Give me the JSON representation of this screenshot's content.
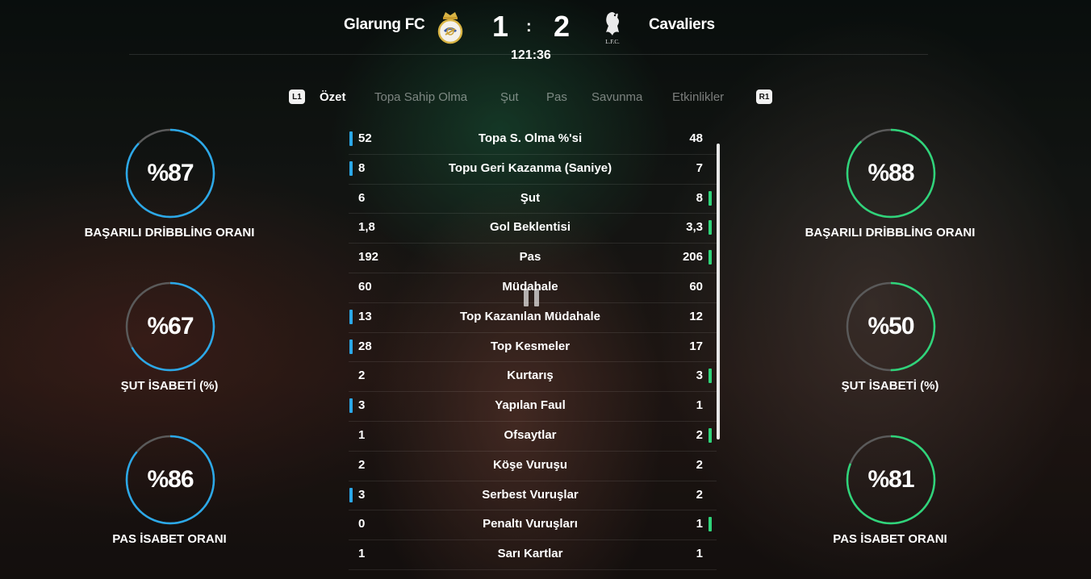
{
  "scoreboard": {
    "home_team": "Glarung FC",
    "away_team": "Cavaliers",
    "home_score": "1",
    "away_score": "2",
    "separator": ":",
    "match_time": "121:36",
    "home_crest_icon": "white-gold-club-crest-icon",
    "away_crest_icon": "liverbird-lfc-crest-icon",
    "away_crest_text": "L.F.C."
  },
  "tabs": {
    "left_button": "L1",
    "right_button": "R1",
    "items": [
      {
        "label": "Özet",
        "active": true
      },
      {
        "label": "Topa Sahip Olma",
        "active": false
      },
      {
        "label": "Şut",
        "active": false
      },
      {
        "label": "Pas",
        "active": false
      },
      {
        "label": "Savunma",
        "active": false
      },
      {
        "label": "Etkinlikler",
        "active": false
      }
    ]
  },
  "colors": {
    "home_accent": "#2ba8e8",
    "away_accent": "#2fd47a",
    "ring_track": "#5a5a5a"
  },
  "home_rings": [
    {
      "value": "%87",
      "label": "BAŞARILI DRİBBLİNG ORANI",
      "fraction": 0.87
    },
    {
      "value": "%67",
      "label": "ŞUT İSABETİ (%)",
      "fraction": 0.67
    },
    {
      "value": "%86",
      "label": "PAS İSABET ORANI",
      "fraction": 0.86
    }
  ],
  "away_rings": [
    {
      "value": "%88",
      "label": "BAŞARILI DRİBBLİNG ORANI",
      "fraction": 0.88
    },
    {
      "value": "%50",
      "label": "ŞUT İSABETİ (%)",
      "fraction": 0.5
    },
    {
      "value": "%81",
      "label": "PAS İSABET ORANI",
      "fraction": 0.81
    }
  ],
  "stats": [
    {
      "name": "Topa S. Olma %'si",
      "home": "52",
      "away": "48",
      "leader": "home"
    },
    {
      "name": "Topu Geri Kazanma (Saniye)",
      "home": "8",
      "away": "7",
      "leader": "home"
    },
    {
      "name": "Şut",
      "home": "6",
      "away": "8",
      "leader": "away"
    },
    {
      "name": "Gol Beklentisi",
      "home": "1,8",
      "away": "3,3",
      "leader": "away"
    },
    {
      "name": "Pas",
      "home": "192",
      "away": "206",
      "leader": "away"
    },
    {
      "name": "Müdahale",
      "home": "60",
      "away": "60",
      "leader": "none"
    },
    {
      "name": "Top Kazanılan Müdahale",
      "home": "13",
      "away": "12",
      "leader": "home"
    },
    {
      "name": "Top Kesmeler",
      "home": "28",
      "away": "17",
      "leader": "home"
    },
    {
      "name": "Kurtarış",
      "home": "2",
      "away": "3",
      "leader": "away"
    },
    {
      "name": "Yapılan Faul",
      "home": "3",
      "away": "1",
      "leader": "home"
    },
    {
      "name": "Ofsaytlar",
      "home": "1",
      "away": "2",
      "leader": "away"
    },
    {
      "name": "Köşe Vuruşu",
      "home": "2",
      "away": "2",
      "leader": "none"
    },
    {
      "name": "Serbest Vuruşlar",
      "home": "3",
      "away": "2",
      "leader": "home"
    },
    {
      "name": "Penaltı Vuruşları",
      "home": "0",
      "away": "1",
      "leader": "away"
    },
    {
      "name": "Sarı Kartlar",
      "home": "1",
      "away": "1",
      "leader": "none"
    }
  ]
}
